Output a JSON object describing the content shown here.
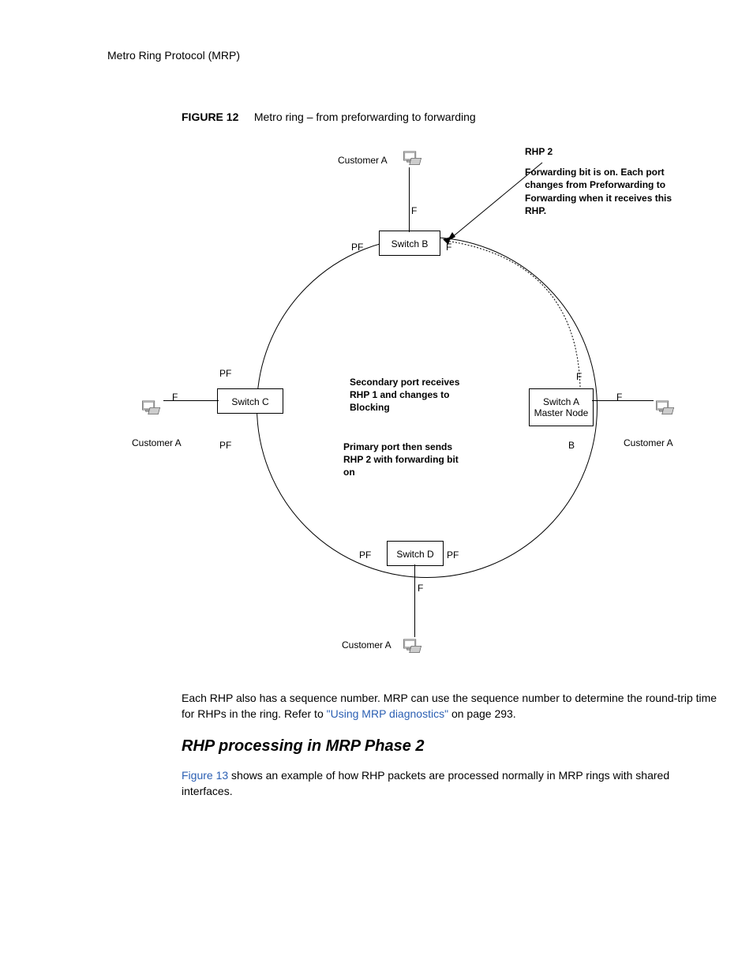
{
  "header": "Metro Ring Protocol (MRP)",
  "figure": {
    "num": "FIGURE 12",
    "title": "Metro ring – from preforwarding to forwarding"
  },
  "switches": {
    "a": "Switch A",
    "a_sub": "Master Node",
    "b": "Switch B",
    "c": "Switch C",
    "d": "Switch D"
  },
  "customers": {
    "top": "Customer A",
    "left": "Customer A",
    "right": "Customer A",
    "bottom": "Customer A"
  },
  "rhp": {
    "label": "RHP 2",
    "desc": "Forwarding bit is on. Each port changes from Preforwarding to Forwarding when it receives this RHP."
  },
  "center1": "Secondary port receives RHP 1 and changes to Blocking",
  "center2": "Primary port then sends RHP 2 with forwarding bit on",
  "ports": {
    "f": "F",
    "pf": "PF",
    "b": "B"
  },
  "para1_a": "Each RHP also has a sequence number.  MRP can use the sequence number to determine the round-trip time for RHPs in the ring.  Refer to ",
  "para1_link": "\"Using MRP diagnostics\"",
  "para1_b": " on page 293.",
  "heading2": "RHP processing in MRP Phase 2",
  "para2_link": "Figure 13",
  "para2": " shows an example of how RHP packets are processed normally in MRP rings with shared interfaces."
}
